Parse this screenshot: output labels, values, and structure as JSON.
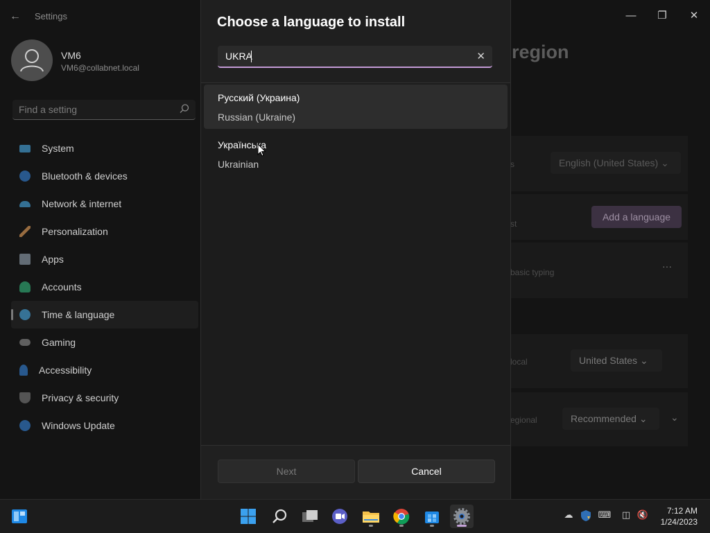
{
  "window": {
    "title": "Settings"
  },
  "user": {
    "name": "VM6",
    "email": "VM6@collabnet.local"
  },
  "search": {
    "placeholder": "Find a setting"
  },
  "nav": [
    {
      "label": "System",
      "icon": "monitor-icon",
      "color": "#4cc2ff"
    },
    {
      "label": "Bluetooth & devices",
      "icon": "bluetooth-icon",
      "color": "#3a8ee6"
    },
    {
      "label": "Network & internet",
      "icon": "wifi-icon",
      "color": "#4cc2ff"
    },
    {
      "label": "Personalization",
      "icon": "brush-icon",
      "color": "#e8a15a"
    },
    {
      "label": "Apps",
      "icon": "apps-icon",
      "color": "#9aa7b5"
    },
    {
      "label": "Accounts",
      "icon": "person-icon",
      "color": "#3fc28a"
    },
    {
      "label": "Time & language",
      "icon": "globe-clock-icon",
      "color": "#4cc2ff"
    },
    {
      "label": "Gaming",
      "icon": "gamepad-icon",
      "color": "#9a9a9a"
    },
    {
      "label": "Accessibility",
      "icon": "accessibility-icon",
      "color": "#3a8ee6"
    },
    {
      "label": "Privacy & security",
      "icon": "shield-icon",
      "color": "#8a8a8a"
    },
    {
      "label": "Windows Update",
      "icon": "update-icon",
      "color": "#3a8ee6"
    }
  ],
  "background": {
    "page_title": "region",
    "frag_s": "s",
    "display_language": "English (United States)",
    "frag_st": "st",
    "add_language": "Add a language",
    "frag_typing": "basic typing",
    "more": "···",
    "frag_local": "local",
    "country": "United States",
    "frag_regional": "egional",
    "regional_format": "Recommended"
  },
  "dialog": {
    "title": "Choose a language to install",
    "search_value": "UKRA",
    "results": [
      {
        "native": "Русский (Украина)",
        "english": "Russian (Ukraine)"
      },
      {
        "native": "Українська",
        "english": "Ukrainian"
      }
    ],
    "next_label": "Next",
    "cancel_label": "Cancel"
  },
  "taskbar": {
    "apps": [
      "start-icon",
      "search-icon",
      "task-view-icon",
      "teams-chat-icon",
      "file-explorer-icon",
      "chrome-icon",
      "store-icon",
      "settings-icon"
    ],
    "time": "7:12 AM",
    "date": "1/24/2023"
  },
  "colors": {
    "accent": "#c39ad6",
    "dialog_bg": "#1f1f1f",
    "window_bg": "#141414"
  }
}
